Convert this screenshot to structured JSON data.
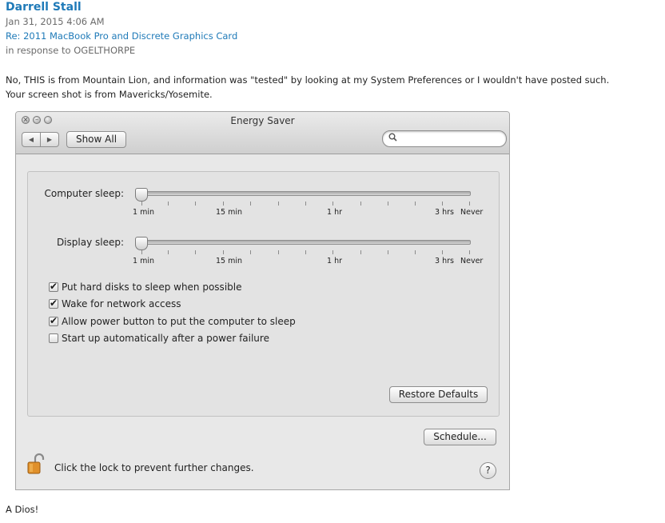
{
  "post": {
    "author": "Darrell Stall",
    "date": "Jan 31, 2015 4:06 AM",
    "thread_link": "Re: 2011 MacBook Pro and Discrete Graphics Card",
    "in_response": "in response to OGELTHORPE",
    "body_line1": "No, THIS is from Mountain Lion, and information was \"tested\" by looking at my System Preferences or I wouldn't have posted such.",
    "body_line2": "Your screen shot is from Mavericks/Yosemite.",
    "signoff": "A Dios!"
  },
  "window": {
    "title": "Energy Saver",
    "show_all": "Show All",
    "back_glyph": "◀",
    "forward_glyph": "▶",
    "search_placeholder": "",
    "search_icon": "magnifier-icon"
  },
  "sliders": {
    "computer_sleep": {
      "label": "Computer sleep:",
      "value": "1 min"
    },
    "display_sleep": {
      "label": "Display sleep:",
      "value": "1 min"
    },
    "tick_labels": {
      "t1": "1 min",
      "t2": "15 min",
      "t3": "1 hr",
      "t4": "3 hrs",
      "t5": "Never"
    }
  },
  "options": {
    "hard_disks": {
      "label": "Put hard disks to sleep when possible",
      "checked": true
    },
    "wake_network": {
      "label": "Wake for network access",
      "checked": true
    },
    "power_button": {
      "label": "Allow power button to put the computer to sleep",
      "checked": true
    },
    "startup_auto": {
      "label": "Start up automatically after a power failure",
      "checked": false
    }
  },
  "buttons": {
    "restore_defaults": "Restore Defaults",
    "schedule": "Schedule..."
  },
  "footer": {
    "lock_text": "Click the lock to prevent further changes.",
    "help": "?"
  }
}
